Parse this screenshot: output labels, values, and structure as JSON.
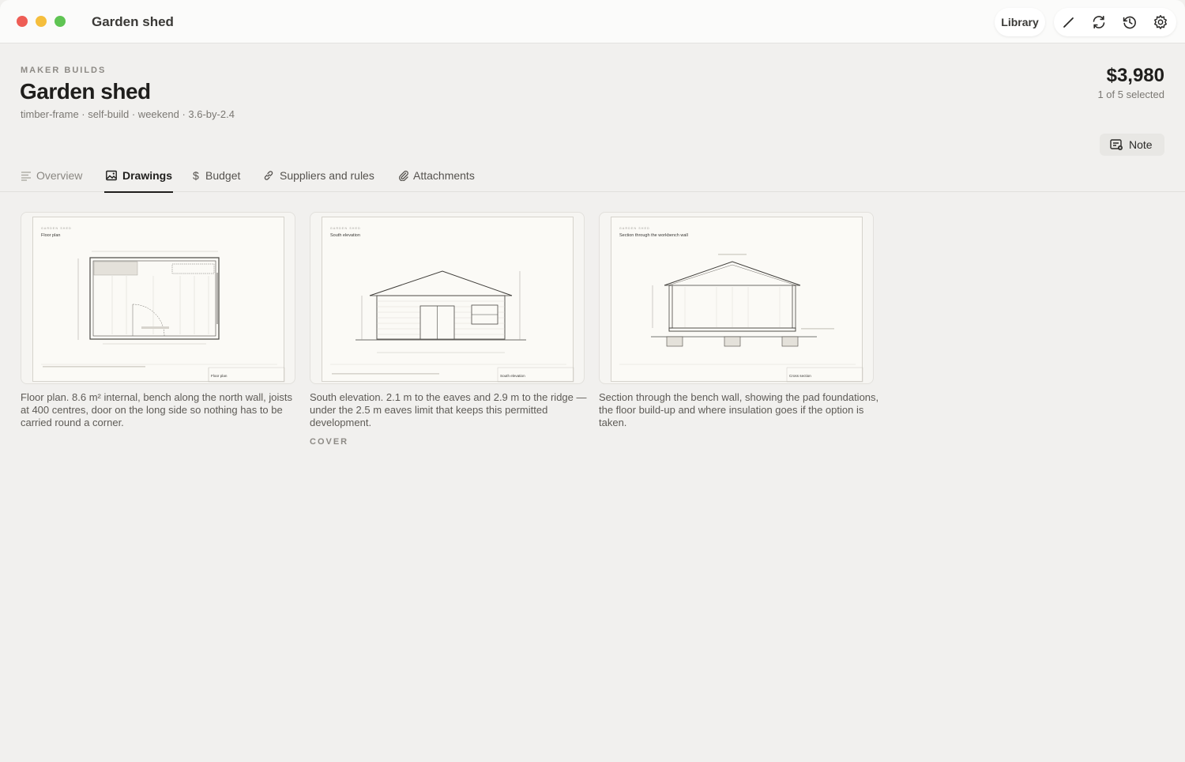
{
  "window": {
    "title": "Garden shed"
  },
  "toolbar": {
    "library_label": "Library",
    "icons": [
      "pencil-icon",
      "sync-icon",
      "history-icon",
      "gear-icon"
    ]
  },
  "header": {
    "eyebrow": "MAKER BUILDS",
    "title": "Garden shed",
    "tags": "timber-frame · self-build · weekend · 3.6-by-2.4",
    "price": "$3,980",
    "selection": "1 of 5 selected",
    "note_label": "Note"
  },
  "tabs": [
    {
      "label": "Overview",
      "icon": "lines-icon",
      "active": false
    },
    {
      "label": "Drawings",
      "icon": "image-icon",
      "active": true
    },
    {
      "label": "Budget",
      "icon": "dollar-icon",
      "active": false
    },
    {
      "label": "Suppliers and rules",
      "icon": "link-icon",
      "active": false
    },
    {
      "label": "Attachments",
      "icon": "paperclip-icon",
      "active": false
    }
  ],
  "drawings": [
    {
      "sheet_heading": "GARDEN SHED",
      "sheet_title": "Floor plan",
      "titleblock_label": "Floor plan",
      "caption": "Floor plan. 8.6 m² internal, bench along the north wall, joists at 400 centres, door on the long side so nothing has to be carried round a corner.",
      "cover": false
    },
    {
      "sheet_heading": "GARDEN SHED",
      "sheet_title": "South elevation",
      "titleblock_label": "South elevation",
      "caption": "South elevation. 2.1 m to the eaves and 2.9 m to the ridge — under the 2.5 m eaves limit that keeps this permitted development.",
      "cover": true,
      "cover_label": "COVER"
    },
    {
      "sheet_heading": "GARDEN SHED",
      "sheet_title": "Section through the workbench wall",
      "titleblock_label": "Cross section",
      "caption": "Section through the bench wall, showing the pad foundations, the floor build-up and where insulation goes if the option is taken.",
      "cover": false
    }
  ]
}
